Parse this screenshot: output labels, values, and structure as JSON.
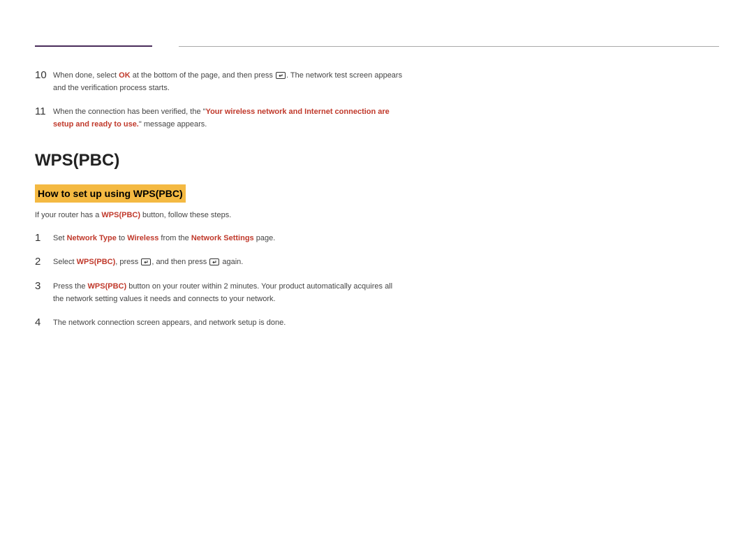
{
  "top_steps": {
    "s10": {
      "num": "10",
      "t1": "When done, select ",
      "ok": "OK",
      "t2": " at the bottom of the page, and then press ",
      "t3": ". The network test screen appears and the verification process starts."
    },
    "s11": {
      "num": "11",
      "t1": "When the connection has been verified, the \"",
      "msg": "Your wireless network and Internet connection are setup and ready to use.",
      "t2": "\" message appears."
    }
  },
  "section_title": "WPS(PBC)",
  "sub_title": "How to set up using WPS(PBC)",
  "intro": {
    "t1": "If your router has a ",
    "bold": "WPS(PBC)",
    "t2": " button, follow these steps."
  },
  "steps": {
    "s1": {
      "num": "1",
      "t1": "Set ",
      "b1": "Network Type",
      "t2": " to ",
      "b2": "Wireless",
      "t3": " from the ",
      "b3": "Network Settings",
      "t4": " page."
    },
    "s2": {
      "num": "2",
      "t1": "Select ",
      "b1": "WPS(PBC)",
      "t2": ", press ",
      "t3": ", and then press ",
      "t4": " again."
    },
    "s3": {
      "num": "3",
      "t1": "Press the ",
      "b1": "WPS(PBC)",
      "t2": " button on your router within 2 minutes. Your product automatically acquires all the network setting values it needs and connects to your network."
    },
    "s4": {
      "num": "4",
      "t1": "The network connection screen appears, and network setup is done."
    }
  }
}
